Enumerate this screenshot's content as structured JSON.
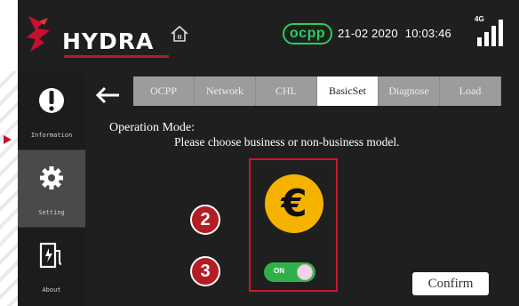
{
  "app": {
    "brand": "HYDRA",
    "status_badge": "ocpp",
    "date": "21-02 2020",
    "time": "10:03:46",
    "network": "4G"
  },
  "sidebar": {
    "items": [
      {
        "label": "Information",
        "icon": "info-icon",
        "active": false
      },
      {
        "label": "Setting",
        "icon": "gear-icon",
        "active": true
      },
      {
        "label": "About",
        "icon": "charger-icon",
        "active": false
      }
    ]
  },
  "tabs": [
    {
      "label": "OCPP",
      "active": false
    },
    {
      "label": "Network",
      "active": false
    },
    {
      "label": "CHL",
      "active": false
    },
    {
      "label": "BasicSet",
      "active": true
    },
    {
      "label": "Diagnose",
      "active": false
    },
    {
      "label": "Load",
      "active": false
    }
  ],
  "main": {
    "mode_title": "Operation Mode:",
    "mode_desc": "Please choose business or non-business model.",
    "currency_symbol": "€",
    "toggle_label": "ON",
    "toggle_state": true,
    "confirm_label": "Confirm"
  },
  "callouts": [
    "2",
    "3"
  ],
  "colors": {
    "accent_red": "#c8102e",
    "ocpp_green": "#26d05a",
    "coin_yellow": "#f5b300",
    "toggle_green": "#2fb14a"
  }
}
